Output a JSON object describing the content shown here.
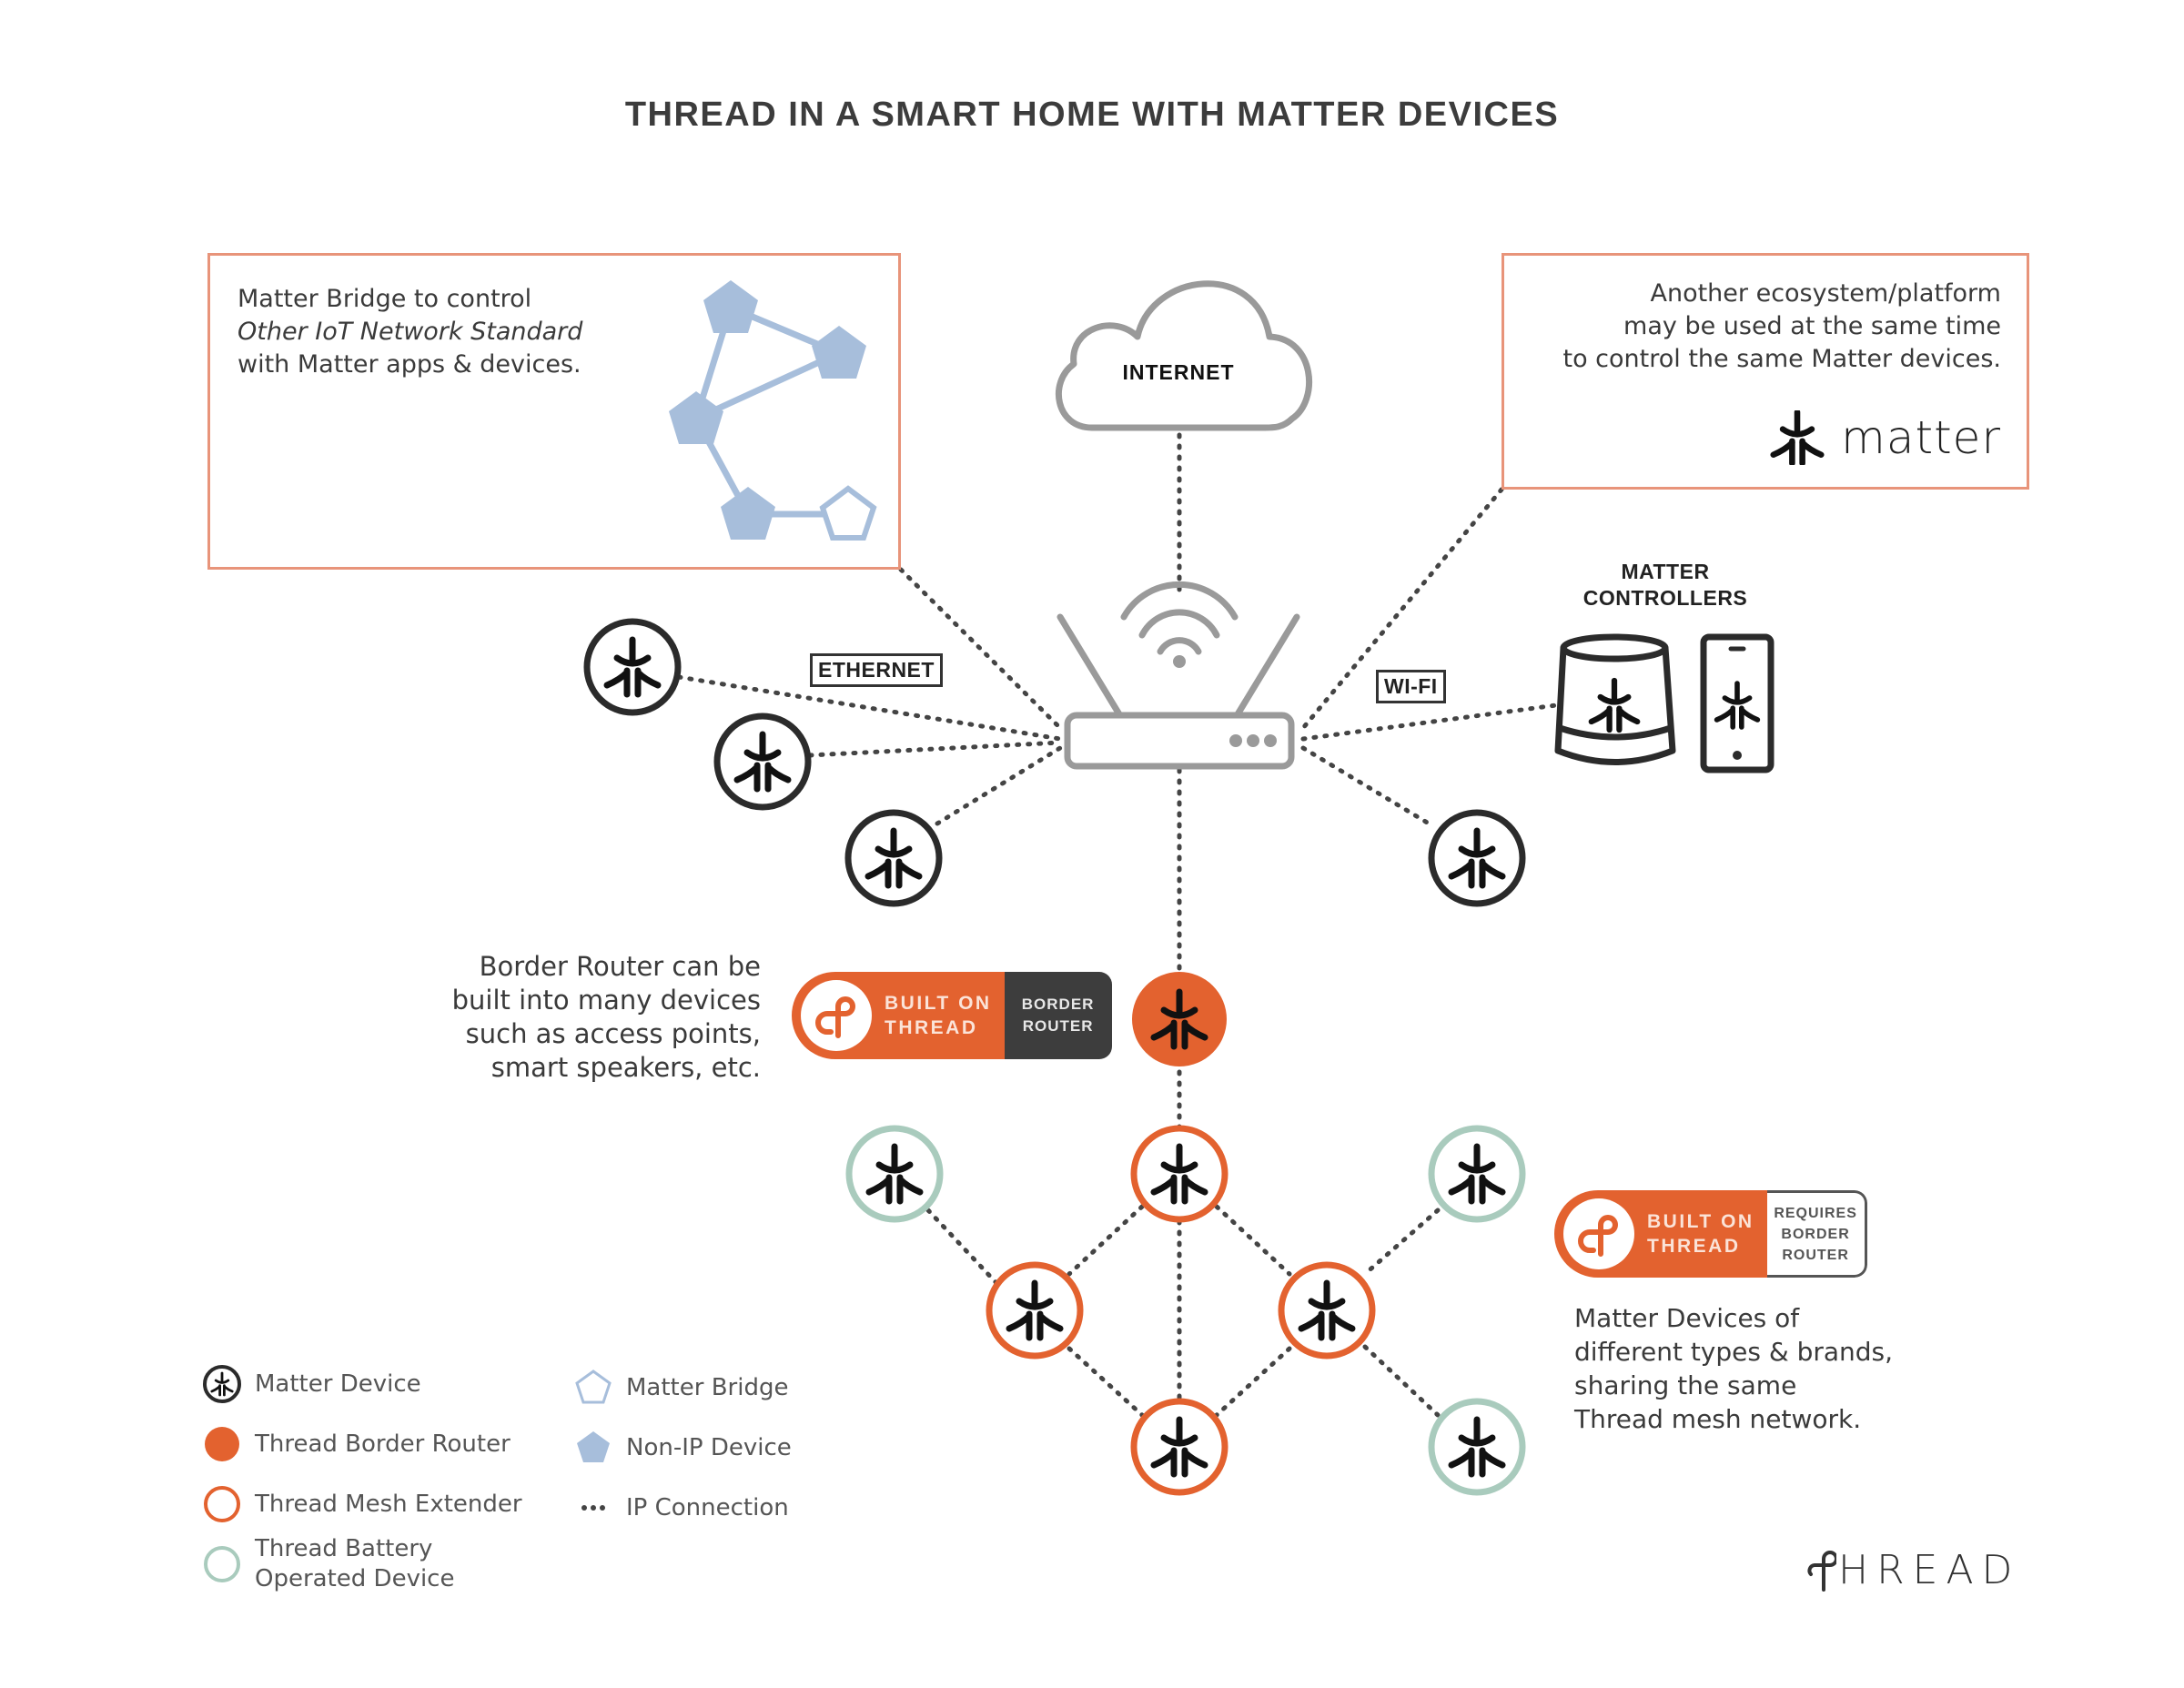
{
  "title": "THREAD IN A SMART HOME WITH MATTER DEVICES",
  "bridge_box": {
    "line1": "Matter Bridge to control",
    "line2": "Other IoT Network Standard",
    "line3": "with Matter apps & devices."
  },
  "ecosystem_box": {
    "line1": "Another ecosystem/platform",
    "line2": "may be used at the same time",
    "line3": "to control the same Matter devices.",
    "logo_text": "matter"
  },
  "cloud": {
    "label": "INTERNET"
  },
  "connection_labels": {
    "ethernet": "ETHERNET",
    "wifi": "WI-FI"
  },
  "controllers": {
    "title_line1": "MATTER",
    "title_line2": "CONTROLLERS"
  },
  "border_router_note": {
    "line1": "Border Router can be",
    "line2": "built into many devices",
    "line3": "such as access points,",
    "line4": "smart speakers, etc."
  },
  "badge_border_router": {
    "built_on": "BUILT ON",
    "thread": "THREAD",
    "right_line1": "BORDER",
    "right_line2": "ROUTER"
  },
  "badge_requires": {
    "built_on": "BUILT ON",
    "thread": "THREAD",
    "right_line1": "REQUIRES",
    "right_line2": "BORDER",
    "right_line3": "ROUTER"
  },
  "mesh_note": {
    "line1": "Matter Devices of",
    "line2": "different types & brands,",
    "line3": "sharing the same",
    "line4": "Thread mesh network."
  },
  "legend": {
    "left": [
      {
        "icon": "matter-device-icon",
        "label": "Matter Device"
      },
      {
        "icon": "thread-border-router-icon",
        "label": "Thread Border Router"
      },
      {
        "icon": "thread-mesh-extender-icon",
        "label": "Thread Mesh Extender"
      },
      {
        "icon": "thread-battery-device-icon",
        "label_line1": "Thread Battery",
        "label_line2": "Operated Device"
      }
    ],
    "right": [
      {
        "icon": "matter-bridge-icon",
        "label": "Matter Bridge"
      },
      {
        "icon": "non-ip-device-icon",
        "label": "Non-IP Device"
      },
      {
        "icon": "ip-connection-icon",
        "label": "IP Connection"
      }
    ]
  },
  "footer_logo": "HREAD",
  "colors": {
    "orange": "#e3622f",
    "box_border": "#e8947a",
    "battery_green": "#a9cbbd",
    "non_ip_blue": "#a7bedb",
    "router_gray": "#9a9a9a",
    "dark": "#2b2b2b",
    "badge_dark": "#3d3d3d"
  }
}
